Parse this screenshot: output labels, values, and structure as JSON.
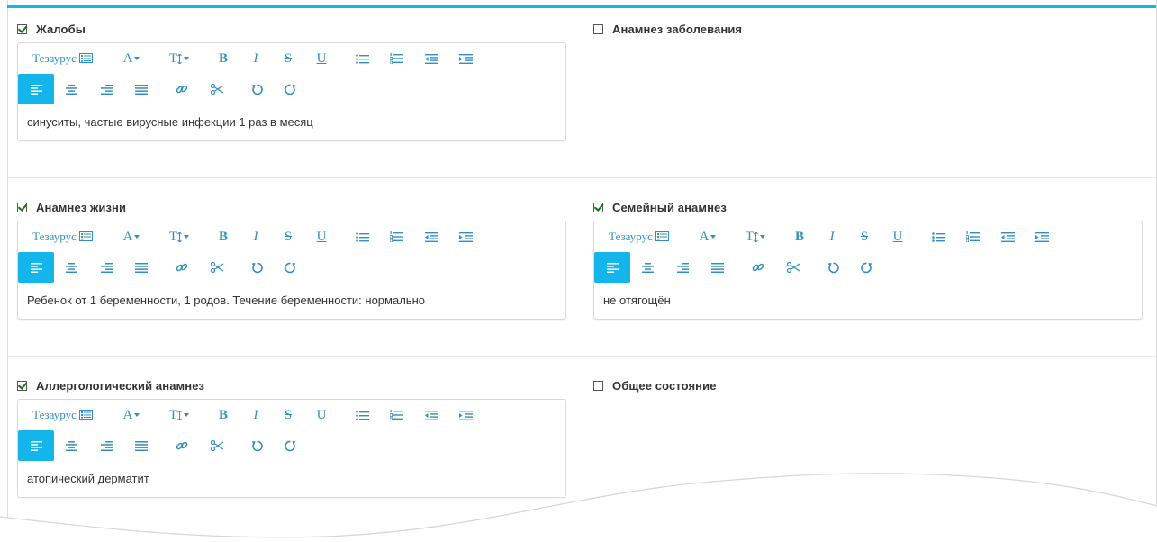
{
  "toolbar": {
    "thesaurus_label": "Тезаурус",
    "font_label": "A",
    "size_label": "T",
    "bold_label": "B",
    "italic_label": "I",
    "strike_label": "S",
    "underline_label": "U"
  },
  "fields": [
    {
      "key": "complaints",
      "label": "Жалобы",
      "checked": true,
      "text": "синуситы,  частые вирусные инфекции 1 раз в месяц"
    },
    {
      "key": "disease_history",
      "label": "Анамнез заболевания",
      "checked": false,
      "text": ""
    },
    {
      "key": "life_history",
      "label": "Анамнез жизни",
      "checked": true,
      "text": "Ребенок от 1 беременности, 1 родов.  Течение беременности: нормально"
    },
    {
      "key": "family_history",
      "label": "Семейный анамнез",
      "checked": true,
      "text": "не отягощён"
    },
    {
      "key": "allergy_history",
      "label": "Аллергологический анамнез",
      "checked": true,
      "text": "атопический дерматит"
    },
    {
      "key": "general_state",
      "label": "Общее состояние",
      "checked": false,
      "text": ""
    }
  ],
  "colors": {
    "accent": "#13b5ea",
    "icon": "#2f8fc0",
    "check": "#1a6e1a"
  }
}
